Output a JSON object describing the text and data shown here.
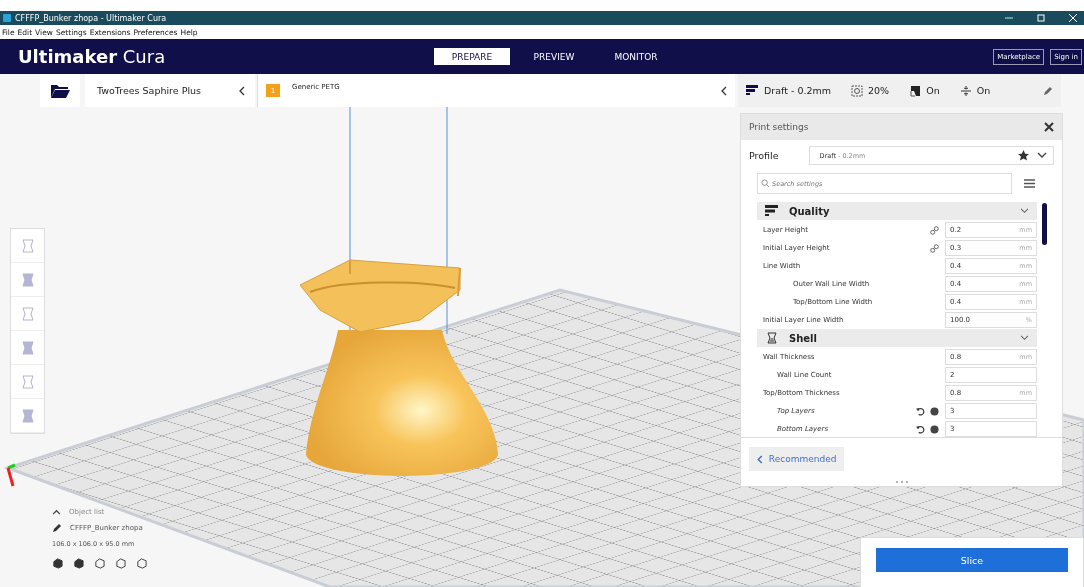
{
  "window": {
    "title": "CFFFP_Bunker zhopa - Ultimaker Cura"
  },
  "menu": [
    "File",
    "Edit",
    "View",
    "Settings",
    "Extensions",
    "Preferences",
    "Help"
  ],
  "header": {
    "logo_bold": "Ultimaker",
    "logo_light": "Cura",
    "stages": [
      {
        "label": "PREPARE",
        "selected": true
      },
      {
        "label": "PREVIEW",
        "selected": false
      },
      {
        "label": "MONITOR",
        "selected": false
      }
    ],
    "buttons": [
      "Marketplace",
      "Sign in"
    ]
  },
  "printer": {
    "name": "TwoTrees Saphire Plus"
  },
  "material": {
    "extruder": "1",
    "name": "Generic PETG"
  },
  "print_setup": {
    "profile": "Draft - 0.2mm",
    "infill": "20%",
    "support": "On",
    "adhesion": "On"
  },
  "print_settings": {
    "title": "Print settings",
    "profile_label": "Profile",
    "profile_name": "Draft",
    "profile_detail": "- 0.2mm",
    "search": {
      "placeholder": "Search settings"
    },
    "sections": [
      {
        "kind": "quality",
        "title": "Quality",
        "settings": [
          {
            "label": "Layer Height",
            "value": "0.2",
            "unit": "mm",
            "linked": true,
            "reset": false
          },
          {
            "label": "Initial Layer Height",
            "value": "0.3",
            "unit": "mm",
            "linked": true,
            "reset": false
          },
          {
            "label": "Line Width",
            "value": "0.4",
            "unit": "mm",
            "linked": false,
            "reset": false,
            "children": [
              {
                "label": "Outer Wall Line Width",
                "value": "0.4",
                "unit": "mm",
                "linked": false,
                "reset": false
              },
              {
                "label": "Top/Bottom Line Width",
                "value": "0.4",
                "unit": "mm",
                "linked": false,
                "reset": false
              }
            ]
          },
          {
            "label": "Initial Layer Line Width",
            "value": "100.0",
            "unit": "%",
            "linked": false,
            "reset": false
          }
        ]
      },
      {
        "kind": "shell",
        "title": "Shell",
        "settings": [
          {
            "label": "Wall Thickness",
            "value": "0.8",
            "unit": "mm",
            "linked": false,
            "reset": false,
            "children": [
              {
                "label": "Wall Line Count",
                "value": "2",
                "linked": false,
                "reset": false
              }
            ]
          },
          {
            "label": "Top/Bottom Thickness",
            "value": "0.8",
            "unit": "mm",
            "linked": false,
            "reset": false,
            "children": [
              {
                "label": "Top Layers",
                "value": "3",
                "linked": false,
                "reset": true
              },
              {
                "label": "Bottom Layers",
                "value": "3",
                "linked": false,
                "reset": true
              }
            ]
          }
        ]
      }
    ],
    "recommended": "Recommended"
  },
  "object_list": {
    "label": "Object list",
    "object": "CFFFP_Bunker zhopa",
    "dimensions": "106.0 x 106.0 x 95.0 mm"
  },
  "slice_button": "Slice"
}
